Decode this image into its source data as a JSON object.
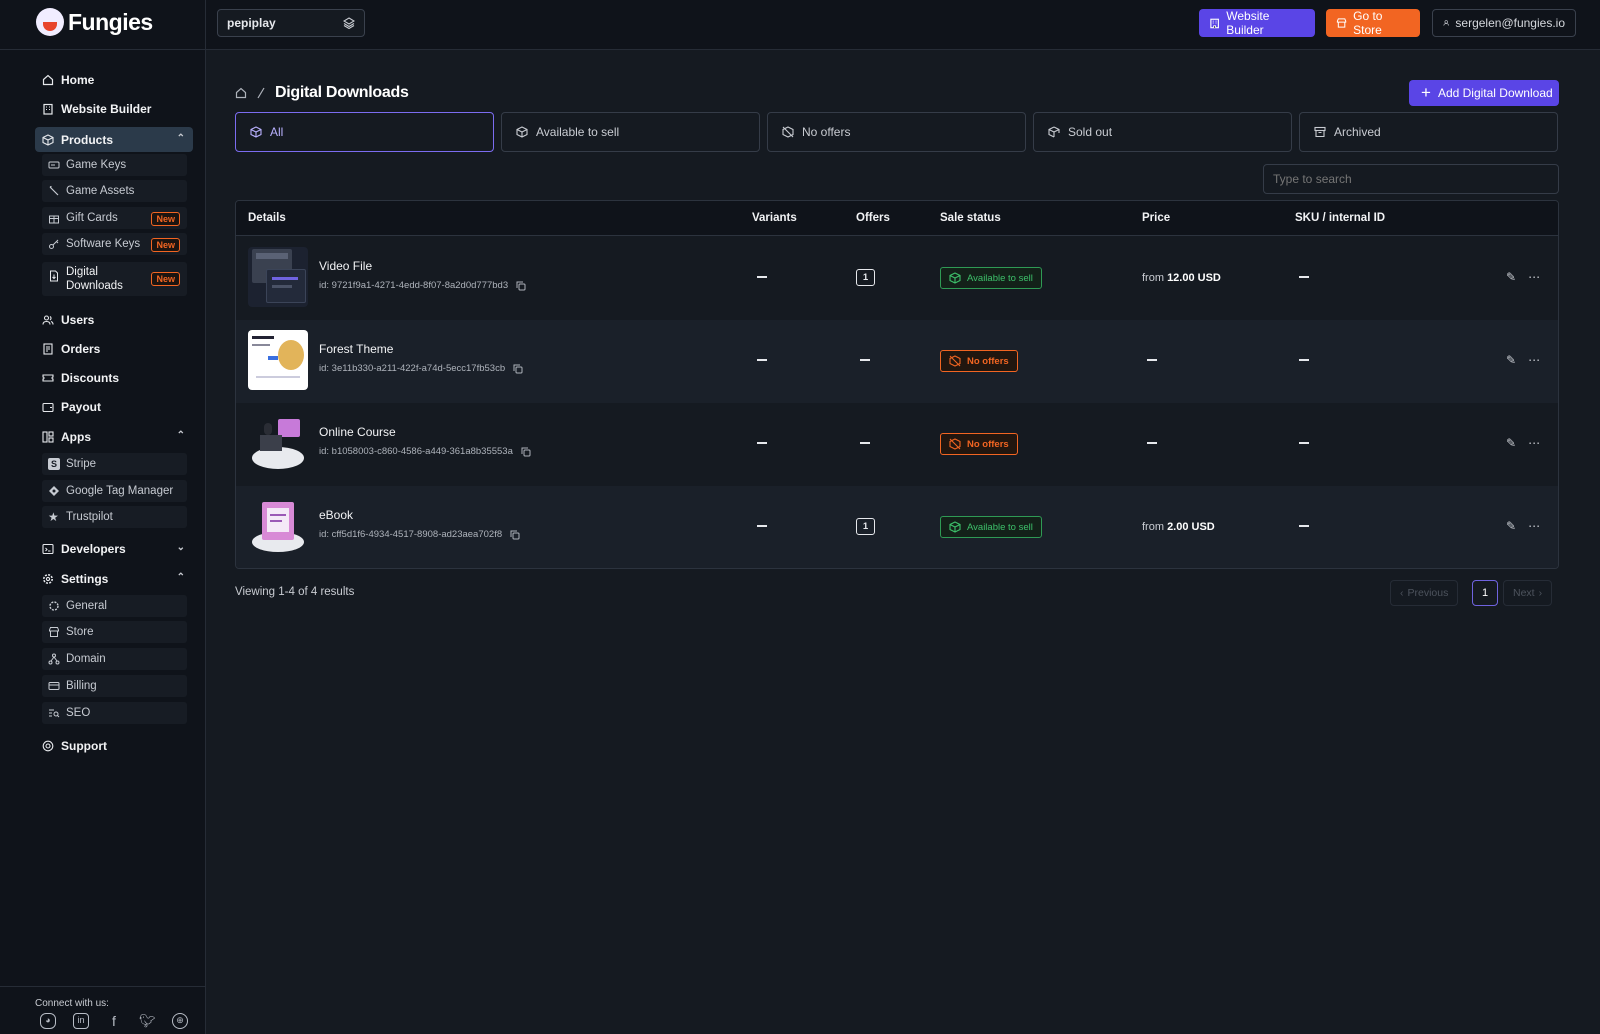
{
  "app": {
    "name": "Fungies"
  },
  "header": {
    "store_name": "pepiplay",
    "website_builder": "Website Builder",
    "go_to_store": "Go to Store",
    "user_email": "sergelen@fungies.io"
  },
  "sidebar": {
    "home": "Home",
    "website_builder": "Website Builder",
    "products": "Products",
    "product_items": [
      {
        "label": "Game Keys",
        "icon": "key-card-icon"
      },
      {
        "label": "Game Assets",
        "icon": "brush-icon"
      },
      {
        "label": "Gift Cards",
        "icon": "gift-icon",
        "badge": "New"
      },
      {
        "label": "Software Keys",
        "icon": "key-icon",
        "badge": "New"
      },
      {
        "label": "Digital Downloads",
        "icon": "file-download-icon",
        "badge": "New"
      }
    ],
    "users": "Users",
    "orders": "Orders",
    "discounts": "Discounts",
    "payout": "Payout",
    "apps": "Apps",
    "app_items": [
      "Stripe",
      "Google Tag Manager",
      "Trustpilot"
    ],
    "developers": "Developers",
    "settings": "Settings",
    "settings_items": [
      "General",
      "Store",
      "Domain",
      "Billing",
      "SEO"
    ],
    "support": "Support",
    "connect": "Connect with us:"
  },
  "page": {
    "title": "Digital Downloads",
    "add_button": "Add Digital Download",
    "tabs": [
      "All",
      "Available to sell",
      "No offers",
      "Sold out",
      "Archived"
    ],
    "search_placeholder": "Type to search",
    "columns": [
      "Details",
      "Variants",
      "Offers",
      "Sale status",
      "Price",
      "SKU / internal ID"
    ],
    "rows": [
      {
        "name": "Video File",
        "id": "id: 9721f9a1-4271-4edd-8f07-8a2d0d777bd3",
        "offers": "1",
        "status": "Available to sell",
        "price_prefix": "from",
        "price": "12.00 USD"
      },
      {
        "name": "Forest Theme",
        "id": "id: 3e11b330-a211-422f-a74d-5ecc17fb53cb",
        "offers": "",
        "status": "No offers",
        "price_prefix": "",
        "price": ""
      },
      {
        "name": "Online Course",
        "id": "id: b1058003-c860-4586-a449-361a8b35553a",
        "offers": "",
        "status": "No offers",
        "price_prefix": "",
        "price": ""
      },
      {
        "name": "eBook",
        "id": "id: cff5d1f6-4934-4517-8908-ad23aea702f8",
        "offers": "1",
        "status": "Available to sell",
        "price_prefix": "from",
        "price": "2.00 USD"
      }
    ],
    "footer": "Viewing 1-4 of 4 results",
    "pagination": {
      "previous": "Previous",
      "current": "1",
      "next": "Next"
    }
  },
  "colors": {
    "accent": "#5a45e6",
    "orange": "#f26522",
    "success": "#3dc06a"
  }
}
